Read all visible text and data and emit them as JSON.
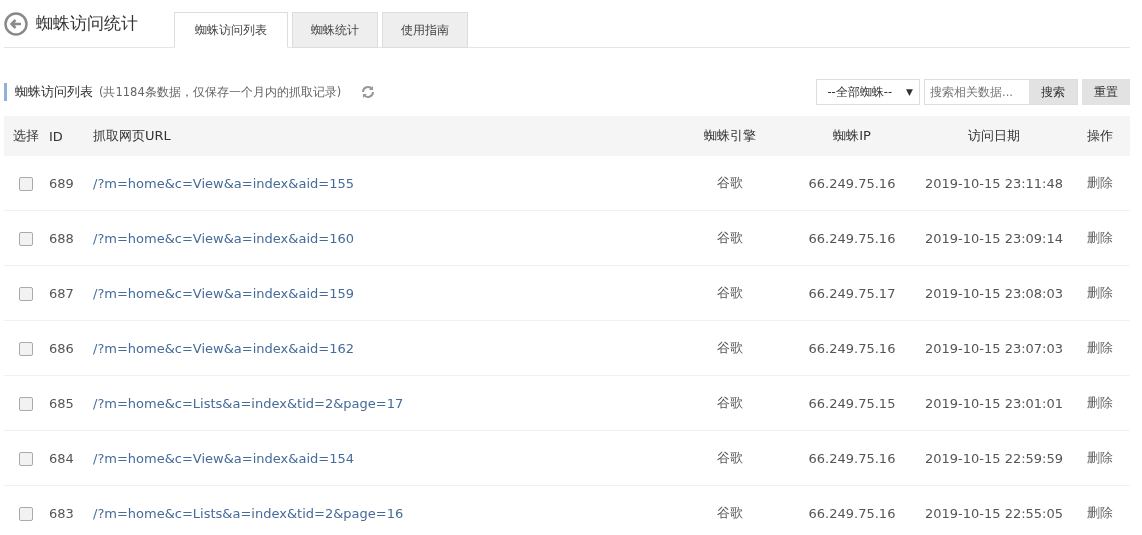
{
  "header": {
    "title": "蜘蛛访问统计"
  },
  "tabs": [
    {
      "label": "蜘蛛访问列表",
      "selected": true
    },
    {
      "label": "蜘蛛统计",
      "selected": false
    },
    {
      "label": "使用指南",
      "selected": false
    }
  ],
  "section": {
    "title": "蜘蛛访问列表",
    "note": "(共1184条数据，仅保存一个月内的抓取记录)"
  },
  "filter": {
    "value": "--全部蜘蛛--",
    "arrow": "▼"
  },
  "search": {
    "placeholder": "搜索相关数据...",
    "button": "搜索"
  },
  "reset_button": "重置",
  "table": {
    "columns": [
      "选择",
      "ID",
      "抓取网页URL",
      "蜘蛛引擎",
      "蜘蛛IP",
      "访问日期",
      "操作"
    ],
    "rows": [
      {
        "checked": false,
        "id": "689",
        "url": "/?m=home&c=View&a=index&aid=155",
        "engine": "谷歌",
        "ip": "66.249.75.16",
        "date": "2019-10-15 23:11:48",
        "action": "删除"
      },
      {
        "checked": false,
        "id": "688",
        "url": "/?m=home&c=View&a=index&aid=160",
        "engine": "谷歌",
        "ip": "66.249.75.16",
        "date": "2019-10-15 23:09:14",
        "action": "删除"
      },
      {
        "checked": false,
        "id": "687",
        "url": "/?m=home&c=View&a=index&aid=159",
        "engine": "谷歌",
        "ip": "66.249.75.17",
        "date": "2019-10-15 23:08:03",
        "action": "删除"
      },
      {
        "checked": false,
        "id": "686",
        "url": "/?m=home&c=View&a=index&aid=162",
        "engine": "谷歌",
        "ip": "66.249.75.16",
        "date": "2019-10-15 23:07:03",
        "action": "删除"
      },
      {
        "checked": false,
        "id": "685",
        "url": "/?m=home&c=Lists&a=index&tid=2&page=17",
        "engine": "谷歌",
        "ip": "66.249.75.15",
        "date": "2019-10-15 23:01:01",
        "action": "删除"
      },
      {
        "checked": false,
        "id": "684",
        "url": "/?m=home&c=View&a=index&aid=154",
        "engine": "谷歌",
        "ip": "66.249.75.16",
        "date": "2019-10-15 22:59:59",
        "action": "删除"
      },
      {
        "checked": false,
        "id": "683",
        "url": "/?m=home&c=Lists&a=index&tid=2&page=16",
        "engine": "谷歌",
        "ip": "66.249.75.16",
        "date": "2019-10-15 22:55:05",
        "action": "删除"
      }
    ]
  }
}
